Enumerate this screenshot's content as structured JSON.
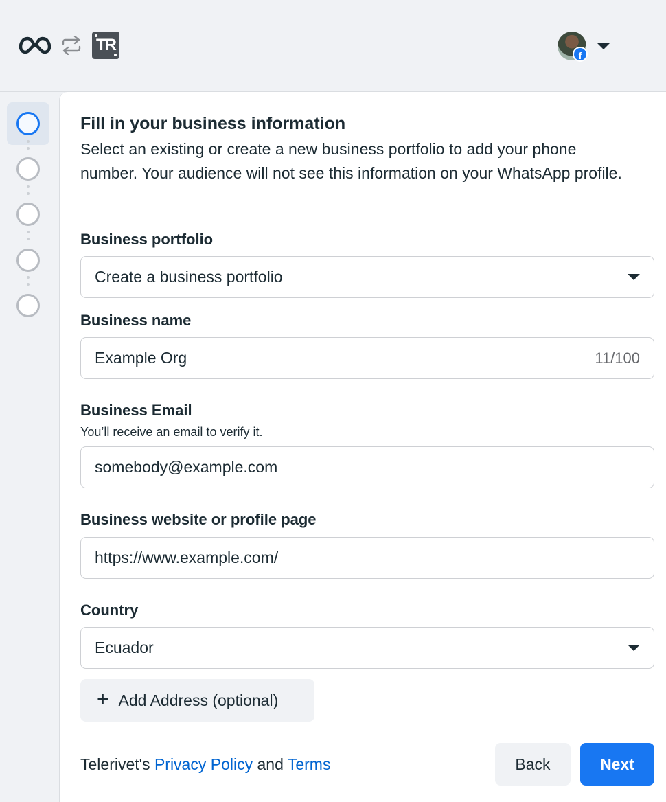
{
  "header": {
    "meta_logo_icon": "meta-infinity-logo",
    "swap_icon": "arrows-swap-icon",
    "partner_logo_text": "TR",
    "account_caret_icon": "caret-down-icon",
    "fb_badge": "f"
  },
  "stepper": {
    "steps": [
      {
        "state": "active"
      },
      {
        "state": "inactive"
      },
      {
        "state": "inactive"
      },
      {
        "state": "inactive"
      },
      {
        "state": "inactive"
      }
    ]
  },
  "form": {
    "title": "Fill in your business information",
    "description": "Select an existing or create a new business portfolio to add your phone number. Your audience will not see this information on your WhatsApp profile.",
    "portfolio_label": "Business portfolio",
    "portfolio_value": "Create a business portfolio",
    "name_label": "Business name",
    "name_value": "Example Org",
    "name_counter": "11/100",
    "email_label": "Business Email",
    "email_help": "You’ll receive an email to verify it.",
    "email_value": "somebody@example.com",
    "website_label": "Business website or profile page",
    "website_value": "https://www.example.com/",
    "country_label": "Country",
    "country_value": "Ecuador",
    "add_address_label": "Add Address (optional)"
  },
  "footer": {
    "prefix": "Telerivet's ",
    "privacy_link": "Privacy Policy",
    "and": " and ",
    "terms_link": "Terms",
    "back_label": "Back",
    "next_label": "Next"
  },
  "colors": {
    "accent": "#1877f2",
    "link": "#0064d1"
  }
}
